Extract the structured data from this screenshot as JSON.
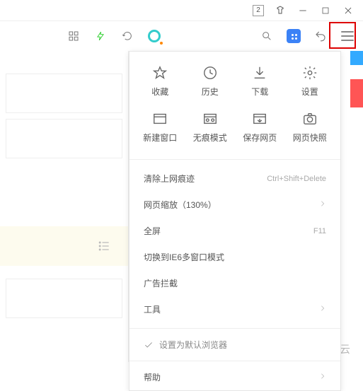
{
  "titlebar": {
    "badge": "2"
  },
  "grid": [
    {
      "name": "favorite-item",
      "label": "收藏",
      "icon": "star"
    },
    {
      "name": "history-item",
      "label": "历史",
      "icon": "clock"
    },
    {
      "name": "download-item",
      "label": "下载",
      "icon": "download"
    },
    {
      "name": "settings-item",
      "label": "设置",
      "icon": "gear"
    },
    {
      "name": "newwin-item",
      "label": "新建窗口",
      "icon": "window"
    },
    {
      "name": "incognito-item",
      "label": "无痕模式",
      "icon": "incognito"
    },
    {
      "name": "savepage-item",
      "label": "保存网页",
      "icon": "save"
    },
    {
      "name": "snapshot-item",
      "label": "网页快照",
      "icon": "camera"
    }
  ],
  "menu": {
    "clear": {
      "label": "清除上网痕迹",
      "shortcut": "Ctrl+Shift+Delete"
    },
    "zoom": {
      "label": "网页缩放（130%）"
    },
    "fullscreen": {
      "label": "全屏",
      "shortcut": "F11"
    },
    "ie6": {
      "label": "切换到IE6多窗口模式"
    },
    "adblock": {
      "label": "广告拦截"
    },
    "tools": {
      "label": "工具"
    },
    "default_browser": {
      "label": "设置为默认浏览器"
    },
    "help": {
      "label": "帮助"
    }
  },
  "watermark": {
    "text": "亿速云"
  }
}
